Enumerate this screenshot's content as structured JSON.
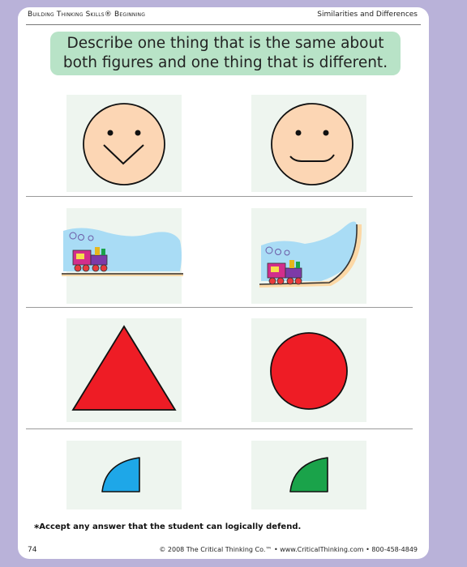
{
  "header": {
    "left": "Building Thinking Skills® Beginning",
    "right": "Similarities and Differences"
  },
  "instruction": {
    "line1": "Describe one thing that is the same about",
    "line2": "both figures and one thing that is different."
  },
  "colors": {
    "page_bg": "#b9b2d9",
    "instruction_bg": "#b8e3c7",
    "panel_bg": "#eef5ef",
    "face": "#fcd6b4",
    "triangle": "#ee1c25",
    "circle": "#ee1c25",
    "quarter_blue": "#1ea7e8",
    "quarter_green": "#1aa34a",
    "sky": "#a9dcf5"
  },
  "rows": [
    {
      "left": "face-v-smile-icon",
      "right": "face-smile-icon"
    },
    {
      "left": "train-flat-icon",
      "right": "train-ramp-icon"
    },
    {
      "left": "triangle-icon",
      "right": "circle-icon"
    },
    {
      "left": "blue-quarter-circle-icon",
      "right": "green-quarter-circle-icon"
    }
  ],
  "footnote": "Accept any answer that the student can logically defend.",
  "footer": {
    "page_number": "74",
    "copyright": "© 2008 The Critical Thinking Co.™ • www.CriticalThinking.com • 800-458-4849"
  }
}
